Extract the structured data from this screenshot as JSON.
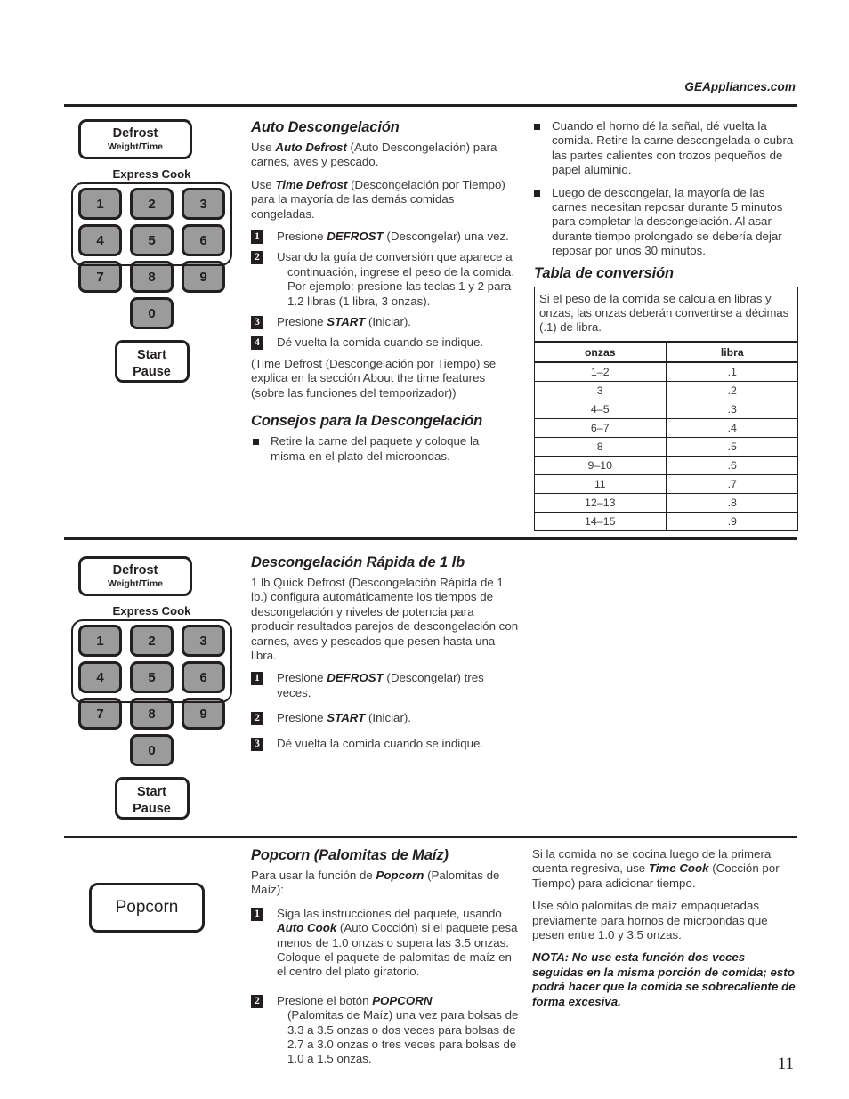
{
  "header": {
    "site_url": "GEAppliances.com"
  },
  "page_number": "11",
  "control_panel": {
    "defrost_button": {
      "line1": "Defrost",
      "line2": "Weight/Time"
    },
    "express_cook_label": "Express Cook",
    "keys": [
      "1",
      "2",
      "3",
      "4",
      "5",
      "6",
      "7",
      "8",
      "9",
      "0"
    ],
    "start_button": {
      "line1": "Start",
      "line2": "Pause"
    },
    "popcorn_button": "Popcorn"
  },
  "section_auto_defrost": {
    "title": "Auto Descongelación",
    "paragraphs": [
      {
        "pre": "Use ",
        "bold": "Auto Defrost",
        "post": " (Auto Descongelación) para carnes, aves y pescado."
      },
      {
        "pre": "Use ",
        "bold": "Time Defrost",
        "post": " (Descongelación por Tiempo) para la mayoría de las demás comidas congeladas."
      }
    ],
    "steps": [
      {
        "num": "1",
        "pre": "Presione ",
        "bold": "DEFROST",
        "post": " (Descongelar) una vez.",
        "cont": ""
      },
      {
        "num": "2",
        "pre": "Usando la guía de conversión que aparece a",
        "bold": "",
        "post": "",
        "cont": "continuación, ingrese el peso de la comida. Por ejemplo: presione las teclas 1 y 2 para 1.2 libras (1 libra, 3 onzas)."
      },
      {
        "num": "3",
        "pre": "Presione ",
        "bold": "START",
        "post": " (Iniciar).",
        "cont": ""
      },
      {
        "num": "4",
        "pre": "Dé vuelta la comida cuando se indique.",
        "bold": "",
        "post": "",
        "cont": ""
      }
    ],
    "footnote": "(Time Defrost (Descongelación por Tiempo) se explica en la sección About the time features (sobre las funciones del temporizador))"
  },
  "section_tips": {
    "title": "Consejos para la Descongelación",
    "bullets": [
      "Retire la carne del paquete y coloque la misma en el plato del microondas."
    ]
  },
  "section_right_bullets": {
    "bullets": [
      "Cuando el horno dé la señal, dé vuelta la comida. Retire la carne descongelada o cubra las partes calientes con trozos pequeños de papel aluminio.",
      "Luego de descongelar, la mayoría de las carnes necesitan reposar durante 5 minutos para completar la descongelación. Al asar durante tiempo prolongado se debería dejar reposar por unos 30 minutos."
    ]
  },
  "conversion_table": {
    "title": "Tabla de conversión",
    "note": "Si el peso de la comida se calcula en libras y onzas, las onzas deberán convertirse a décimas (.1) de libra.",
    "headers": [
      "onzas",
      "libra"
    ],
    "rows": [
      [
        "1–2",
        ".1"
      ],
      [
        "3",
        ".2"
      ],
      [
        "4–5",
        ".3"
      ],
      [
        "6–7",
        ".4"
      ],
      [
        "8",
        ".5"
      ],
      [
        "9–10",
        ".6"
      ],
      [
        "11",
        ".7"
      ],
      [
        "12–13",
        ".8"
      ],
      [
        "14–15",
        ".9"
      ]
    ]
  },
  "section_quick_defrost": {
    "title": "Descongelación Rápida de 1 lb",
    "paragraph": "1 lb Quick Defrost (Descongelación Rápida de 1 lb.) configura automáticamente los tiempos de descongelación y niveles de potencia para producir resultados parejos de descongelación con carnes, aves y pescados que pesen  hasta una libra.",
    "steps": [
      {
        "num": "1",
        "pre": "Presione ",
        "bold": "DEFROST",
        "post": " (Descongelar) tres veces."
      },
      {
        "num": "2",
        "pre": "Presione ",
        "bold": "START",
        "post": " (Iniciar)."
      },
      {
        "num": "3",
        "pre": "Dé vuelta la comida cuando se indique.",
        "bold": "",
        "post": ""
      }
    ]
  },
  "section_popcorn": {
    "title": "Popcorn (Palomitas de Maíz)",
    "intro_pre": "Para usar la función de ",
    "intro_bold": "Popcorn",
    "intro_post": " (Palomitas de Maíz):",
    "steps": [
      {
        "num": "1",
        "line1": "Siga las instrucciones del paquete, usando",
        "bold": "Auto Cook",
        "rest": " (Auto Cocción) si el paquete pesa menos de 1.0 onzas o supera las 3.5 onzas. Coloque el paquete de palomitas de maíz en el centro del plato giratorio."
      },
      {
        "num": "2",
        "line1": "Presione el botón ",
        "bold": "POPCORN",
        "rest": " (Palomitas de Maíz) una vez para bolsas de 3.3 a 3.5 onzas o dos veces para bolsas de 2.7 a 3.0 onzas o tres veces para bolsas de 1.0 a 1.5 onzas."
      }
    ],
    "right_paragraph_1_pre": "Si la comida no se cocina luego de la primera cuenta regresiva, use ",
    "right_paragraph_1_bold": "Time Cook",
    "right_paragraph_1_post": " (Cocción por Tiempo) para adicionar tiempo.",
    "right_paragraph_2": "Use sólo palomitas de maíz empaquetadas previamente para hornos de microondas que pesen entre  1.0 y 3.5 onzas.",
    "right_note": "NOTA: No use esta función dos veces seguidas en la misma porción de comida; esto podrá hacer que la comida se sobrecaliente de forma excesiva."
  }
}
